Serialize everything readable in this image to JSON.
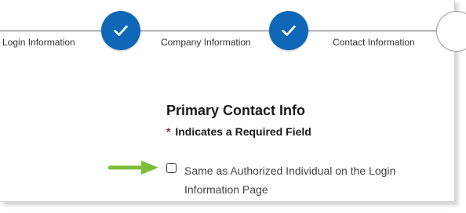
{
  "stepper": {
    "steps": [
      {
        "label": "Login Information",
        "status": "complete",
        "icon": "check-icon"
      },
      {
        "label": "Company Information",
        "status": "complete",
        "icon": "check-icon"
      },
      {
        "label": "Contact Information",
        "status": "current"
      },
      {
        "status": "upcoming"
      }
    ],
    "colors": {
      "complete": "#0f67b8",
      "line": "#5a5a5a"
    }
  },
  "form": {
    "title": "Primary Contact Info",
    "required_asterisk": "*",
    "required_text": "Indicates a Required Field",
    "checkbox": {
      "label": "Same as Authorized Individual on the Login Information Page",
      "checked": false
    },
    "colors": {
      "asterisk": "#a02434"
    }
  },
  "annotation": {
    "arrow_color": "#7dbf3a",
    "icon": "arrow-right-icon"
  }
}
